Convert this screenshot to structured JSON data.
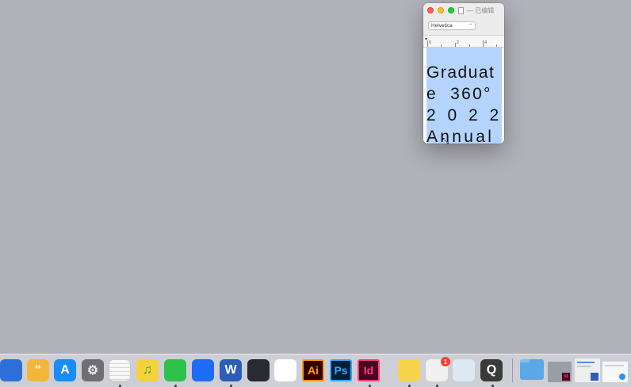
{
  "window": {
    "title": "已编辑",
    "font_name": "Helvetica",
    "ruler_numbers": [
      "0",
      "2",
      "4"
    ],
    "document_lines": [
      "Graduat",
      "e 360°",
      "2 0 2 2",
      "Annual"
    ]
  },
  "dock": {
    "apps": [
      {
        "name": "Keynote",
        "icon": "keynote-icon",
        "color": "#2d6fd8",
        "label": ""
      },
      {
        "name": "Pages",
        "icon": "pages-icon",
        "color": "#f4b63a",
        "label": "“"
      },
      {
        "name": "App Store",
        "icon": "app-store-icon",
        "color": "#1a8cf6",
        "label": "A"
      },
      {
        "name": "System Preferences",
        "icon": "gear-icon",
        "color": "#6e6e73",
        "label": "⚙"
      },
      {
        "name": "TextEdit",
        "icon": "textedit-icon",
        "color": "#f3f3f3",
        "label": ""
      },
      {
        "name": "QQ Music",
        "icon": "qq-music-icon",
        "color": "#f5d23a",
        "label": "♫"
      },
      {
        "name": "WeChat",
        "icon": "wechat-icon",
        "color": "#2ec24b",
        "label": ""
      },
      {
        "name": "Lark",
        "icon": "lark-icon",
        "color": "#1e6cf5",
        "label": ""
      },
      {
        "name": "Word",
        "icon": "word-icon",
        "color": "#2b5eb7",
        "label": "W"
      },
      {
        "name": "OBS",
        "icon": "obs-icon",
        "color": "#2a2a33",
        "label": ""
      },
      {
        "name": "Baidu Netdisk",
        "icon": "baidu-netdisk-icon",
        "color": "#ffffff",
        "label": ""
      },
      {
        "name": "Illustrator",
        "icon": "illustrator-icon",
        "color": "#330000",
        "label": "Ai"
      },
      {
        "name": "Photoshop",
        "icon": "photoshop-icon",
        "color": "#001e36",
        "label": "Ps"
      },
      {
        "name": "InDesign",
        "icon": "indesign-icon",
        "color": "#49021f",
        "label": "Id"
      },
      {
        "name": "Stickies",
        "icon": "stickies-icon",
        "color": "#f7d34a",
        "label": ""
      },
      {
        "name": "Microsoft Store",
        "icon": "store-icon",
        "color": "#f0f0f0",
        "label": ""
      },
      {
        "name": "Calculator",
        "icon": "calculator-icon",
        "color": "#dce9f3",
        "label": ""
      },
      {
        "name": "QuickTime",
        "icon": "quicktime-icon",
        "color": "#3a3a3a",
        "label": "Q"
      }
    ],
    "badge_count": "1",
    "recent": [
      {
        "name": "Folder",
        "icon": "folder-icon"
      },
      {
        "name": "InDesign document",
        "icon": "indesign-doc-icon"
      },
      {
        "name": "Word document",
        "icon": "word-doc-icon"
      },
      {
        "name": "Finder window",
        "icon": "finder-window-icon"
      }
    ]
  }
}
